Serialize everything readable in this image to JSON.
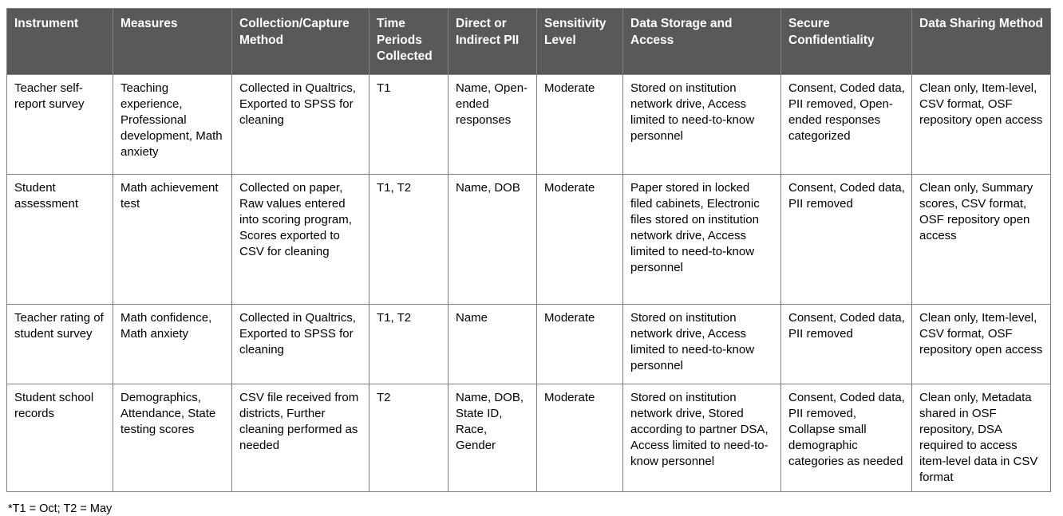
{
  "table": {
    "headers": [
      "Instrument",
      "Measures",
      "Collection/Capture Method",
      "Time Periods Collected",
      "Direct or Indirect PII",
      "Sensitivity Level",
      "Data Storage and Access",
      "Secure Confidentiality",
      "Data Sharing Method"
    ],
    "rows": [
      {
        "instrument": "Teacher self-report survey",
        "measures": "Teaching experience, Professional development, Math anxiety",
        "collection_method": "Collected in Qualtrics, Exported to SPSS for cleaning",
        "time_periods": "T1",
        "pii": "Name, Open-ended responses",
        "sensitivity": "Moderate",
        "storage_access": "Stored on institution network drive, Access limited to need-to-know personnel",
        "confidentiality": "Consent, Coded data, PII removed, Open-ended responses categorized",
        "sharing_method": "Clean only, Item-level, CSV format, OSF repository open access"
      },
      {
        "instrument": "Student assessment",
        "measures": "Math achievement test",
        "collection_method": "Collected on paper, Raw values entered into scoring program, Scores exported to CSV for cleaning",
        "time_periods": "T1, T2",
        "pii": "Name, DOB",
        "sensitivity": "Moderate",
        "storage_access": "Paper stored in locked filed cabinets, Electronic files stored on institution network drive, Access limited to need-to-know personnel",
        "confidentiality": "Consent, Coded data, PII removed",
        "sharing_method": "Clean only, Summary scores, CSV format, OSF repository open access"
      },
      {
        "instrument": "Teacher rating of student survey",
        "measures": "Math confidence, Math anxiety",
        "collection_method": "Collected in Qualtrics, Exported to SPSS for cleaning",
        "time_periods": "T1, T2",
        "pii": "Name",
        "sensitivity": "Moderate",
        "storage_access": "Stored on institution network drive, Access limited to need-to-know personnel",
        "confidentiality": "Consent, Coded data, PII removed",
        "sharing_method": "Clean only, Item-level, CSV format, OSF repository open access"
      },
      {
        "instrument": "Student school records",
        "measures": "Demographics, Attendance, State testing scores",
        "collection_method": "CSV file received from districts, Further cleaning performed as needed",
        "time_periods": "T2",
        "pii": "Name, DOB, State ID, Race, Gender",
        "sensitivity": "Moderate",
        "storage_access": "Stored on institution network drive, Stored according to partner DSA, Access limited to need-to-know personnel",
        "confidentiality": "Consent, Coded data, PII removed, Collapse small demographic categories as needed",
        "sharing_method": "Clean only, Metadata shared in OSF repository, DSA required to access item-level data in CSV format"
      }
    ]
  },
  "footnote": "*T1 = Oct; T2 = May",
  "colors": {
    "header_background": "#595959",
    "header_text": "#ffffff",
    "border": "#808080",
    "body_background": "#ffffff",
    "body_text": "#000000"
  }
}
